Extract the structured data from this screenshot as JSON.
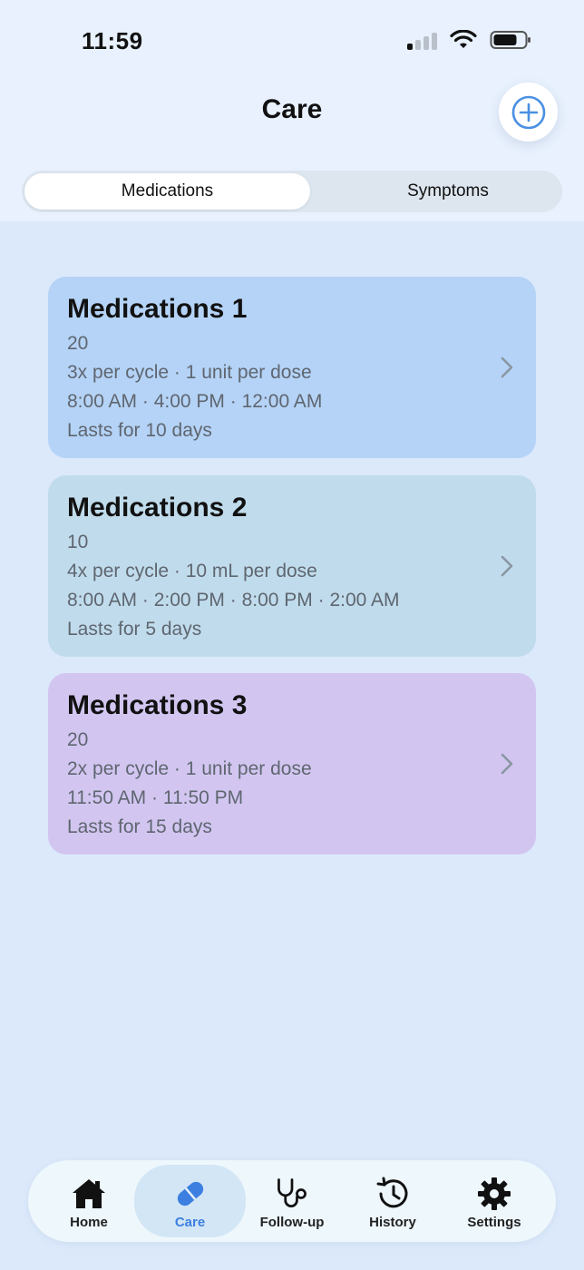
{
  "status_bar": {
    "time": "11:59"
  },
  "header": {
    "title": "Care"
  },
  "segments": [
    "Medications",
    "Symptoms"
  ],
  "medications": [
    {
      "name": "Medications 1",
      "quantity": "20",
      "schedule": "3x per cycle · 1 unit per dose",
      "times": "8:00 AM · 4:00 PM · 12:00 AM",
      "duration": "Lasts for 10 days",
      "color": "#b4d3f6"
    },
    {
      "name": "Medications 2",
      "quantity": "10",
      "schedule": "4x per cycle · 10 mL per dose",
      "times": "8:00 AM · 2:00 PM · 8:00 PM · 2:00 AM",
      "duration": "Lasts for 5 days",
      "color": "#c0dcec"
    },
    {
      "name": "Medications 3",
      "quantity": "20",
      "schedule": "2x per cycle · 1 unit per dose",
      "times": "11:50 AM · 11:50 PM",
      "duration": "Lasts for 15 days",
      "color": "#d2c6f1"
    }
  ],
  "tabs": [
    {
      "label": "Home",
      "icon": "home-icon"
    },
    {
      "label": "Care",
      "icon": "pill-icon"
    },
    {
      "label": "Follow-up",
      "icon": "stethoscope-icon"
    },
    {
      "label": "History",
      "icon": "history-icon"
    },
    {
      "label": "Settings",
      "icon": "gear-icon"
    }
  ],
  "colors": {
    "accent": "#3c7fe0",
    "background": "#dce9fb"
  }
}
